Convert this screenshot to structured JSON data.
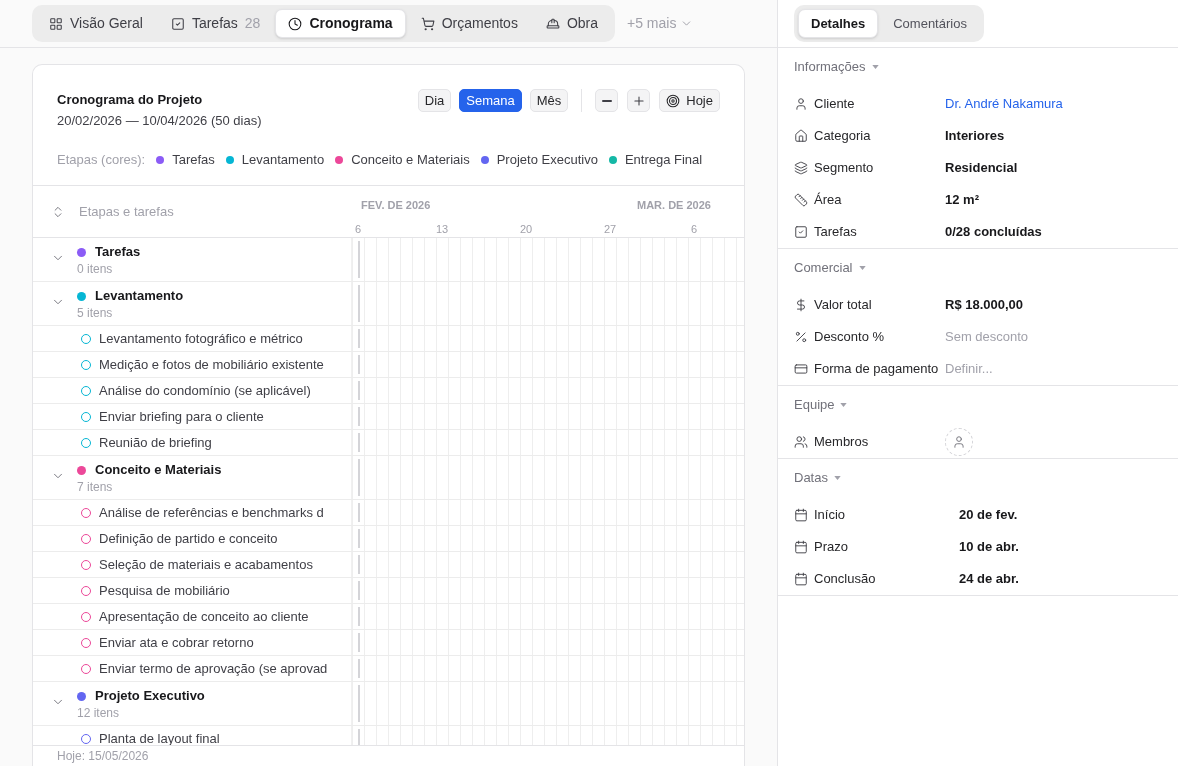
{
  "nav": {
    "tabs": [
      {
        "label": "Visão Geral",
        "selected": false
      },
      {
        "label": "Tarefas",
        "count": "28",
        "selected": false
      },
      {
        "label": "Cronograma",
        "selected": true
      },
      {
        "label": "Orçamentos",
        "selected": false
      },
      {
        "label": "Obra",
        "selected": false
      }
    ],
    "more": "+5 mais"
  },
  "schedule": {
    "title": "Cronograma do Projeto",
    "range": "20/02/2026 — 10/04/2026 (50 dias)",
    "scales": [
      {
        "label": "Dia",
        "selected": false
      },
      {
        "label": "Semana",
        "selected": true
      },
      {
        "label": "Mês",
        "selected": false
      }
    ],
    "today_button": "Hoje",
    "legend": {
      "label": "Etapas (cores):",
      "items": [
        {
          "label": "Tarefas",
          "color": "#8b5cf6"
        },
        {
          "label": "Levantamento",
          "color": "#06b6d4"
        },
        {
          "label": "Conceito e Materiais",
          "color": "#ec4899"
        },
        {
          "label": "Projeto Executivo",
          "color": "#6366f1"
        },
        {
          "label": "Entrega Final",
          "color": "#14b8a6"
        }
      ]
    },
    "column_header": "Etapas e tarefas",
    "months": [
      "FEV. DE 2026",
      "MAR. DE 2026"
    ],
    "ticks": [
      "6",
      "13",
      "20",
      "27",
      "6"
    ],
    "groups": [
      {
        "name": "Tarefas",
        "count": "0 itens",
        "color": "#8b5cf6",
        "expanded": true
      },
      {
        "name": "Levantamento",
        "count": "5 itens",
        "color": "#06b6d4",
        "expanded": true,
        "children": [
          {
            "name": "Levantamento fotográfico e métrico",
            "checked": false
          },
          {
            "name": "Medição e fotos de mobiliário existente",
            "checked": false
          },
          {
            "name": "Análise do condomínio (se aplicável)",
            "checked": false
          },
          {
            "name": "Enviar briefing para o cliente",
            "checked": false
          },
          {
            "name": "Reunião de briefing",
            "checked": false
          }
        ]
      },
      {
        "name": "Conceito e Materiais",
        "count": "7 itens",
        "color": "#ec4899",
        "expanded": true,
        "children": [
          {
            "name": "Análise de referências e benchmarks d",
            "checked": false
          },
          {
            "name": "Definição de partido e conceito",
            "checked": false
          },
          {
            "name": "Seleção de materiais e acabamentos",
            "checked": false
          },
          {
            "name": "Pesquisa de mobiliário",
            "checked": false
          },
          {
            "name": "Apresentação de conceito ao cliente",
            "checked": false
          },
          {
            "name": "Enviar ata e cobrar retorno",
            "checked": false
          },
          {
            "name": "Enviar termo de aprovação (se aprovad",
            "checked": false
          }
        ]
      },
      {
        "name": "Projeto Executivo",
        "count": "12 itens",
        "color": "#6366f1",
        "expanded": true,
        "children": [
          {
            "name": "Planta de layout final",
            "checked": false
          }
        ]
      }
    ],
    "footer": "Hoje: 15/05/2026"
  },
  "details": {
    "tabs": [
      {
        "label": "Detalhes",
        "selected": true
      },
      {
        "label": "Comentários",
        "selected": false
      }
    ],
    "sections": [
      {
        "title": "Informações",
        "expanded": true,
        "fields": [
          {
            "label": "Cliente",
            "value": "Dr. André Nakamura",
            "kind": "link"
          },
          {
            "label": "Categoria",
            "value": "Interiores",
            "kind": "text"
          },
          {
            "label": "Segmento",
            "value": "Residencial",
            "kind": "text"
          },
          {
            "label": "Área",
            "value": "12 m²",
            "kind": "text"
          },
          {
            "label": "Tarefas",
            "value": "0/28 concluídas",
            "kind": "text"
          }
        ]
      },
      {
        "title": "Comercial",
        "expanded": true,
        "fields": [
          {
            "label": "Valor total",
            "value": "R$ 18.000,00",
            "kind": "text"
          },
          {
            "label": "Desconto %",
            "placeholder": "Sem desconto",
            "kind": "empty"
          },
          {
            "label": "Forma de pagamento",
            "placeholder": "Definir...",
            "kind": "empty"
          }
        ]
      },
      {
        "title": "Equipe",
        "expanded": true,
        "fields": [
          {
            "label": "Membros",
            "kind": "avatar"
          }
        ]
      },
      {
        "title": "Datas",
        "expanded": true,
        "fields": [
          {
            "label": "Início",
            "value": "20 de fev.",
            "kind": "date"
          },
          {
            "label": "Prazo",
            "value": "10 de abr.",
            "kind": "date"
          },
          {
            "label": "Conclusão",
            "value": "24 de abr.",
            "kind": "date"
          }
        ]
      }
    ]
  }
}
